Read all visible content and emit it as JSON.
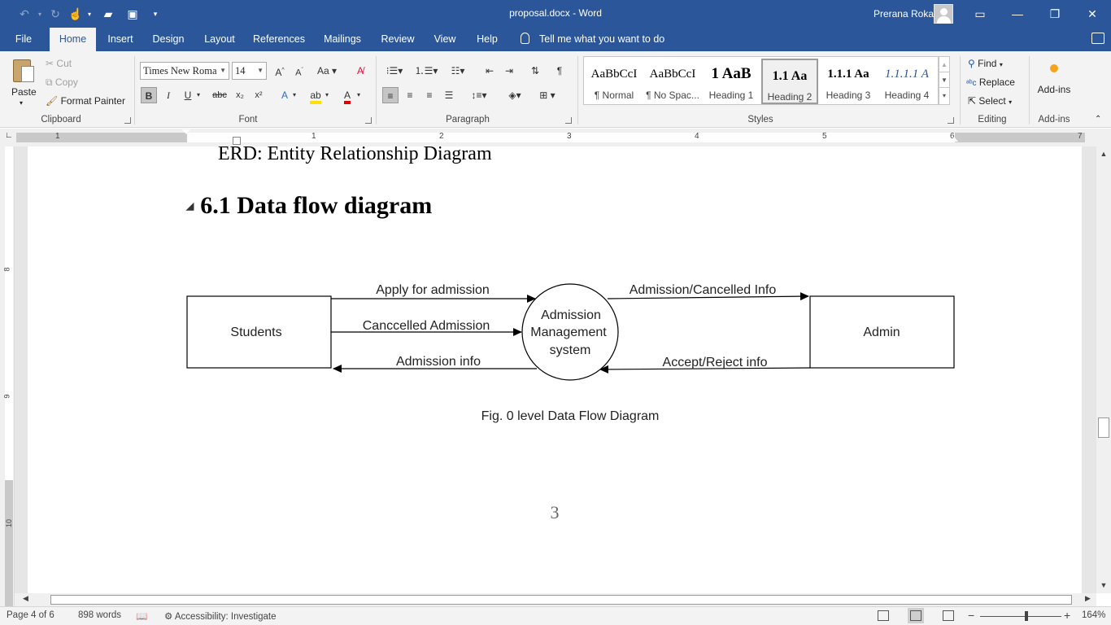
{
  "window": {
    "title": "proposal.docx  -  Word",
    "user": "Prerana Roka"
  },
  "tabs": [
    "File",
    "Home",
    "Insert",
    "Design",
    "Layout",
    "References",
    "Mailings",
    "Review",
    "View",
    "Help"
  ],
  "active_tab": "Home",
  "tell_me": "Tell me what you want to do",
  "clipboard": {
    "paste": "Paste",
    "cut": "Cut",
    "copy": "Copy",
    "format_painter": "Format Painter",
    "label": "Clipboard"
  },
  "font": {
    "name": "Times New Roma",
    "size": "14",
    "label": "Font"
  },
  "paragraph": {
    "label": "Paragraph"
  },
  "styles": {
    "label": "Styles",
    "items": [
      {
        "preview": "AaBbCcI",
        "name": "¶ Normal"
      },
      {
        "preview": "AaBbCcI",
        "name": "¶ No Spac..."
      },
      {
        "preview": "1  AaB",
        "name": "Heading 1"
      },
      {
        "preview": "1.1  Aa",
        "name": "Heading 2"
      },
      {
        "preview": "1.1.1  Aa",
        "name": "Heading 3"
      },
      {
        "preview": "1.1.1.1  A",
        "name": "Heading 4"
      }
    ],
    "selected": "Heading 2"
  },
  "editing": {
    "find": "Find",
    "replace": "Replace",
    "select": "Select",
    "label": "Editing"
  },
  "addins": {
    "button": "Add-ins",
    "label": "Add-ins"
  },
  "ruler": {
    "numbers": [
      "1",
      "1",
      "2",
      "3",
      "4",
      "5",
      "6",
      "7"
    ],
    "vertical_numbers": [
      "8",
      "9",
      "10"
    ]
  },
  "document": {
    "erd_line": "ERD: Entity Relationship Diagram",
    "heading": "6.1 Data flow diagram",
    "page_number": "3"
  },
  "dfd": {
    "students": "Students",
    "admin": "Admin",
    "process": [
      "Admission",
      "Management",
      "system"
    ],
    "flows": {
      "apply": "Apply for admission",
      "cancelled": "Canccelled Admission",
      "admission_info": "Admission info",
      "admission_cancelled_info": "Admission/Cancelled Info",
      "accept_reject": "Accept/Reject info"
    },
    "caption": "Fig. 0 level Data Flow Diagram"
  },
  "status": {
    "page": "Page 4 of 6",
    "words": "898 words",
    "accessibility": "Accessibility: Investigate",
    "zoom": "164%"
  }
}
